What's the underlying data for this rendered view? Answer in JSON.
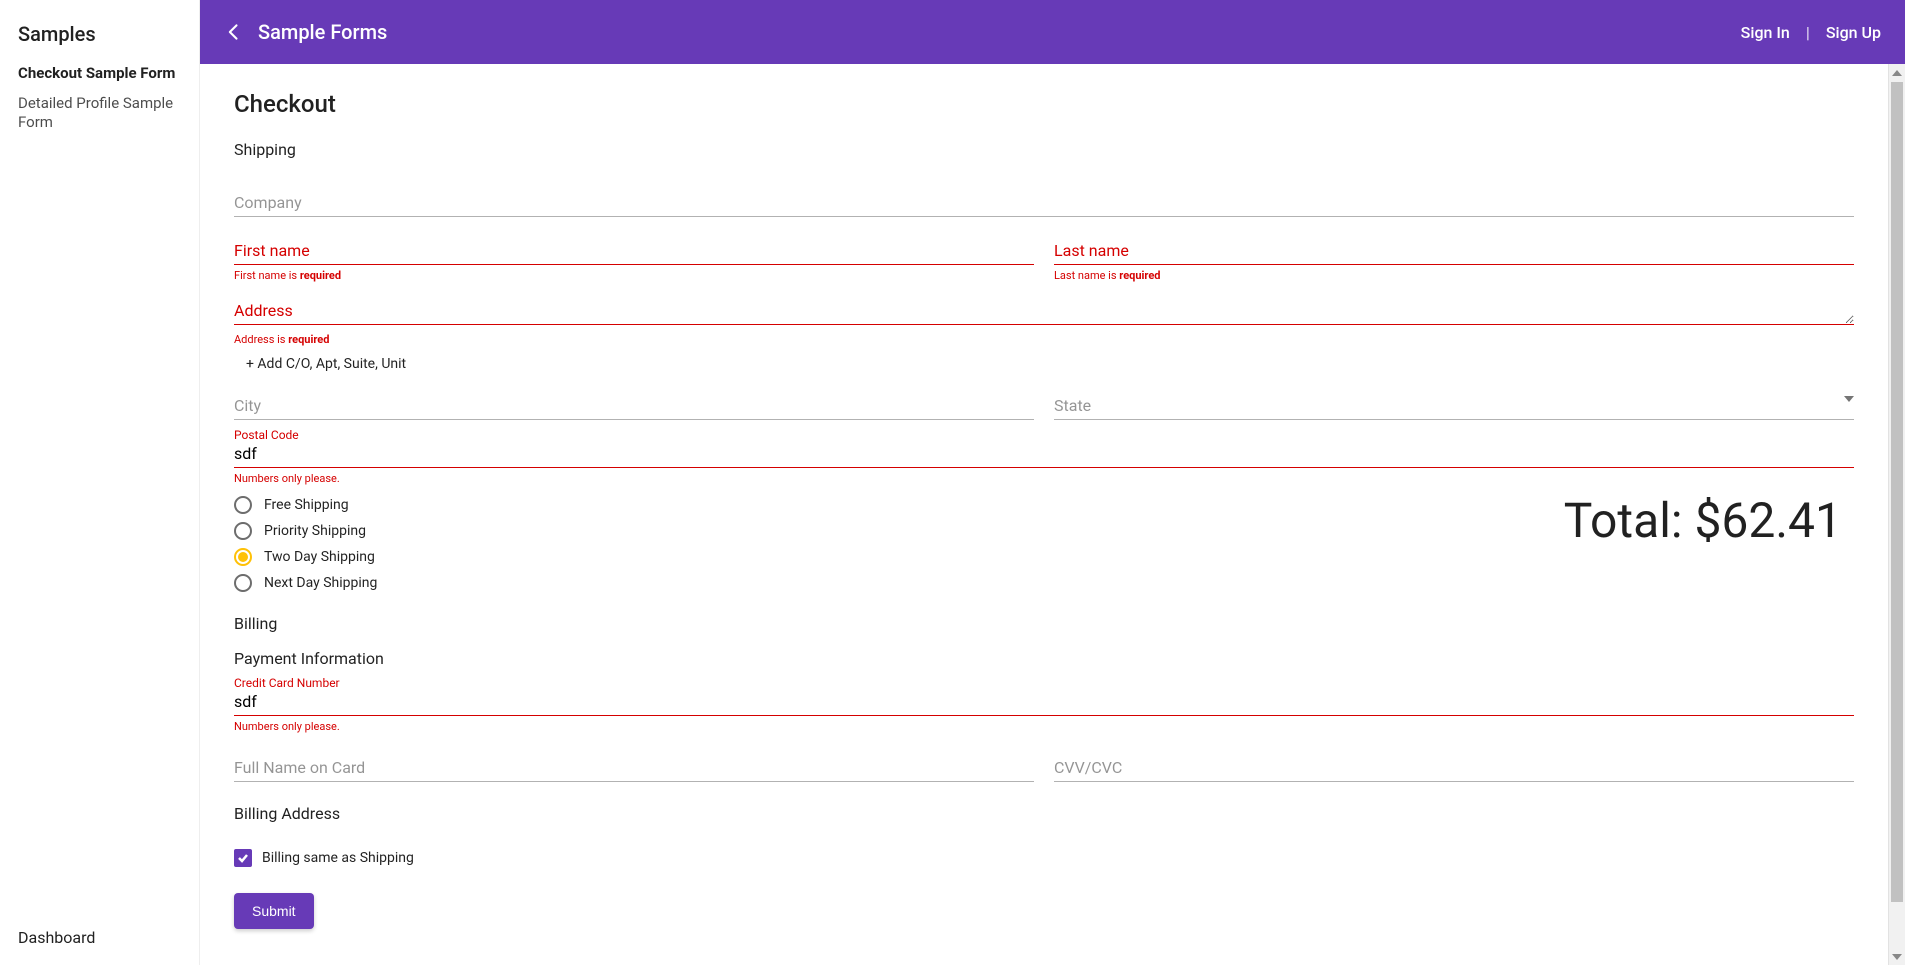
{
  "sidebar": {
    "title": "Samples",
    "items": [
      {
        "label": "Checkout Sample Form",
        "active": true
      },
      {
        "label": "Detailed Profile Sample Form",
        "active": false
      }
    ],
    "bottom": "Dashboard"
  },
  "topbar": {
    "title": "Sample Forms",
    "signin": "Sign In",
    "signup": "Sign Up",
    "divider": "|"
  },
  "page": {
    "title": "Checkout",
    "shipping_title": "Shipping",
    "billing_title": "Billing",
    "payment_title": "Payment Information",
    "billing_address_title": "Billing Address"
  },
  "fields": {
    "company": {
      "label": "Company",
      "value": ""
    },
    "first_name": {
      "label": "First name",
      "value": "",
      "error_prefix": "First name is ",
      "error_req": "required"
    },
    "last_name": {
      "label": "Last name",
      "value": "",
      "error_prefix": "Last name is ",
      "error_req": "required"
    },
    "address": {
      "label": "Address",
      "value": "",
      "error_prefix": "Address is ",
      "error_req": "required"
    },
    "add_line": "+ Add C/O, Apt, Suite, Unit",
    "city": {
      "label": "City",
      "value": ""
    },
    "state": {
      "label": "State",
      "value": ""
    },
    "postal": {
      "label": "Postal Code",
      "value": "sdf",
      "error": "Numbers only please."
    },
    "cc_number": {
      "label": "Credit Card Number",
      "value": "sdf",
      "error": "Numbers only please."
    },
    "cc_name": {
      "label": "Full Name on Card",
      "value": ""
    },
    "cc_cvv": {
      "label": "CVV/CVC",
      "value": ""
    }
  },
  "shipping_options": [
    {
      "label": "Free Shipping",
      "selected": false
    },
    {
      "label": "Priority Shipping",
      "selected": false
    },
    {
      "label": "Two Day Shipping",
      "selected": true
    },
    {
      "label": "Next Day Shipping",
      "selected": false
    }
  ],
  "total": {
    "label": "Total: ",
    "value": "$62.41"
  },
  "billing_same": {
    "label": "Billing same as Shipping",
    "checked": true
  },
  "submit_label": "Submit"
}
